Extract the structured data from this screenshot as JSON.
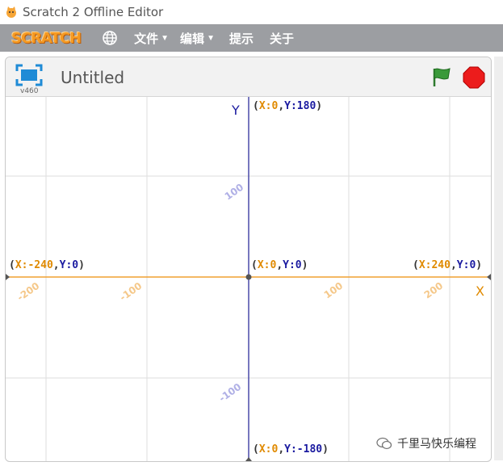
{
  "window": {
    "title": "Scratch 2 Offline Editor"
  },
  "menubar": {
    "logo": "SCRATCH",
    "items": [
      {
        "label": "文件",
        "caret": "▼"
      },
      {
        "label": "编辑",
        "caret": "▼"
      },
      {
        "label": "提示",
        "caret": ""
      },
      {
        "label": "关于",
        "caret": ""
      }
    ]
  },
  "stage_header": {
    "version": "v460",
    "project_title": "Untitled"
  },
  "stage": {
    "axis_labels": {
      "x": "X",
      "y": "Y"
    },
    "x_ticks": [
      "-200",
      "-100",
      "100",
      "200"
    ],
    "y_ticks": [
      "100",
      "-100"
    ],
    "coord_labels": {
      "top": {
        "x": "X:0",
        "y": "Y:180"
      },
      "left": {
        "x": "X:-240",
        "y": "Y:0"
      },
      "center": {
        "x": "X:0",
        "y": "Y:0"
      },
      "right": {
        "x": "X:240",
        "y": "Y:0"
      },
      "bottom": {
        "x": "X:0",
        "y": "Y:-180"
      }
    },
    "colors": {
      "x_axis": "#f0a030",
      "y_axis": "#4a4aa8",
      "grid": "#dddddd"
    }
  },
  "watermark": {
    "text": "千里马快乐编程"
  }
}
